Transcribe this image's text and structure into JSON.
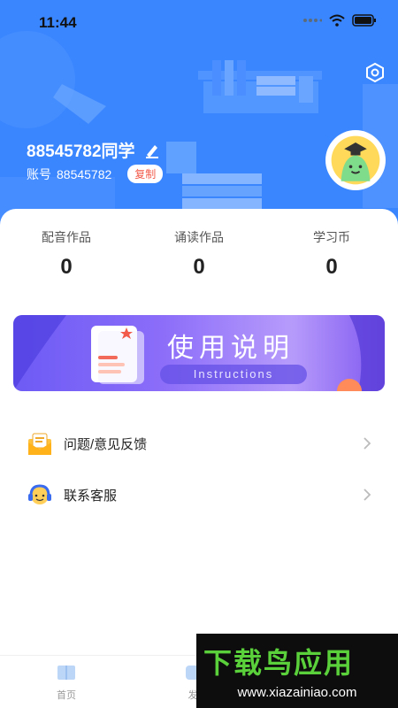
{
  "status_bar": {
    "time": "11:44"
  },
  "profile": {
    "username": "88545782同学",
    "account_label": "账号",
    "account_id": "88545782",
    "copy_label": "复制"
  },
  "stats": [
    {
      "label": "配音作品",
      "value": "0"
    },
    {
      "label": "诵读作品",
      "value": "0"
    },
    {
      "label": "学习币",
      "value": "0"
    }
  ],
  "banner": {
    "title": "使用说明",
    "subtitle": "Instructions"
  },
  "menu": [
    {
      "label": "问题/意见反馈",
      "icon": "feedback-envelope-icon"
    },
    {
      "label": "联系客服",
      "icon": "customer-service-icon"
    }
  ],
  "tabbar": {
    "tabs": [
      {
        "label": "首页"
      },
      {
        "label": "发"
      }
    ]
  },
  "watermark": {
    "title": "下载鸟应用",
    "url": "www.xiazainiao.com"
  },
  "colors": {
    "header_blue": "#3a86ff",
    "copy_red": "#f25a4a",
    "watermark_green": "#5ad03a"
  }
}
